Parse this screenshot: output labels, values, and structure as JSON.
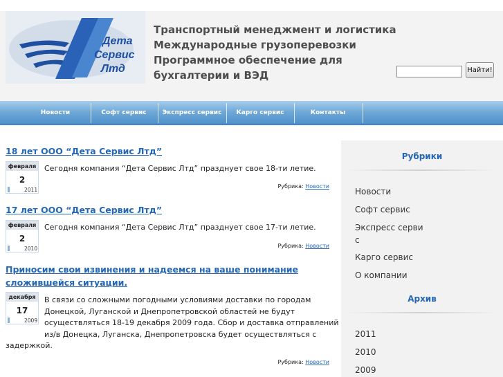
{
  "header": {
    "logo_text": [
      "Дета",
      "Сервис",
      "Лтд"
    ],
    "tagline": [
      "Транспортный менеджмент и логистика",
      "Международные грузоперевозки",
      "Программное обеспечение для",
      "бухгалтерии и ВЭД"
    ],
    "search": {
      "value": "",
      "button_label": "Найти!"
    }
  },
  "nav": {
    "items": [
      "Новости",
      "Софт сервис",
      "Экспресс сервис",
      "Карго сервис",
      "Контакты"
    ]
  },
  "posts": [
    {
      "title": [
        "18 лет ООО “Дета Сервис Лтд”"
      ],
      "month": "февраля",
      "day": "2",
      "year": "2011",
      "text": [
        "Сегодня компания “Дета Сервис Лтд” празднует свое 18-ти летие."
      ],
      "rubric_label": "Рубрика:",
      "rubric_link": "Новости"
    },
    {
      "title": [
        "17 лет ООО “Дета Сервис Лтд”"
      ],
      "month": "февраля",
      "day": "2",
      "year": "2010",
      "text": [
        "Сегодня компания “Дета Сервис Лтд” празднует свое 17-ти летие."
      ],
      "rubric_label": "Рубрика:",
      "rubric_link": "Новости"
    },
    {
      "title": [
        "Приносим свои извинения и надеемся на ваше понимание",
        "сложившейся ситуации."
      ],
      "month": "декабря",
      "day": "17",
      "year": "2009",
      "text": [
        "В связи со сложными погодными условиями доставки по        городам",
        "Донецкой, Луганской и Днепропетровской областей не будут",
        "осуществляться 18-19 декабря 2009 года. Сбор и доставка отправлений",
        "из/в Донецка, Луганска,      Днепропетровска будет осуществляться с",
        "задержкой."
      ],
      "rubric_label": "Рубрика:",
      "rubric_link": "Новости"
    }
  ],
  "sidebar": {
    "rubrics_title": "Рубрики",
    "rubrics": [
      [
        "Новости"
      ],
      [
        "Софт сервис"
      ],
      [
        "Экспресс серви",
        "с"
      ],
      [
        "Карго сервис"
      ],
      [
        "О компании"
      ]
    ],
    "archive_title": "Архив",
    "archive": [
      "2011",
      "2010",
      "2009"
    ]
  },
  "colors": {
    "link": "#2467b4",
    "nav_gradient_top": "#a8cdea",
    "nav_gradient_bottom": "#4e8fcb",
    "header_bg": "#f3f3f3",
    "sidebar_bg": "#f2f2f2"
  }
}
